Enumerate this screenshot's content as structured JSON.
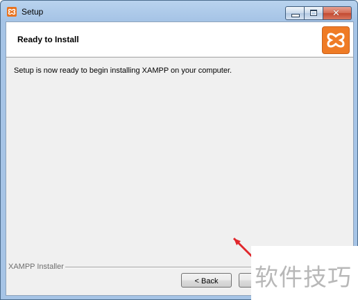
{
  "window": {
    "title": "Setup"
  },
  "header": {
    "title": "Ready to Install"
  },
  "body": {
    "message": "Setup is now ready to begin installing XAMPP on your computer."
  },
  "footer": {
    "group_label": "XAMPP Installer",
    "back_label": "< Back",
    "next_label": ""
  },
  "overlay": {
    "watermark_text": "软件技巧"
  },
  "icons": {
    "app": "xampp-logo-icon",
    "minimize": "minimize-icon",
    "maximize": "maximize-icon",
    "close": "close-icon",
    "annotation": "red-arrow-icon"
  },
  "colors": {
    "brand_orange": "#ef7b25",
    "annotation_red": "#e0262b"
  }
}
